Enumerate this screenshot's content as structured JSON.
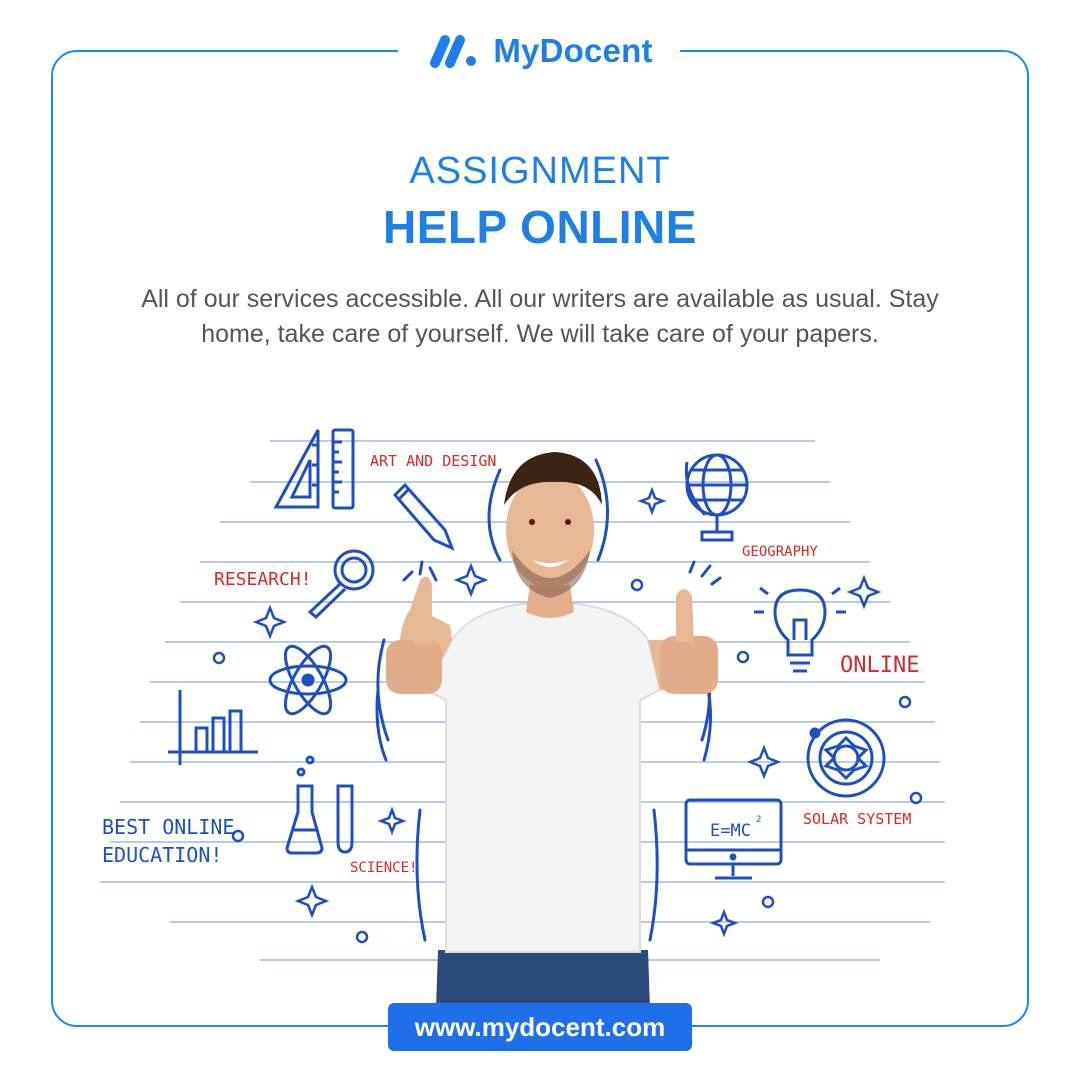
{
  "brand": {
    "name": "MyDocent",
    "primary_color": "#1e7fe6",
    "doodle_blue": "#1f4fbf",
    "doodle_red": "#d42a2a"
  },
  "heading": {
    "line1": "ASSIGNMENT",
    "line2": "HELP ONLINE"
  },
  "description": "All of our services accessible. All our writers are available as usual. Stay home, take care of yourself. We will take care of your papers.",
  "doodles": {
    "art_and_design": "ART AND DESIGN",
    "geography": "GEOGRAPHY",
    "research": "RESEARCH!",
    "online": "ONLINE",
    "best_online": "BEST ONLINE",
    "education": "EDUCATION!",
    "science": "SCIENCE!",
    "solar_system": "SOLAR SYSTEM",
    "formula": "E=MC",
    "formula_exp": "2"
  },
  "footer": {
    "url": "www.mydocent.com"
  }
}
